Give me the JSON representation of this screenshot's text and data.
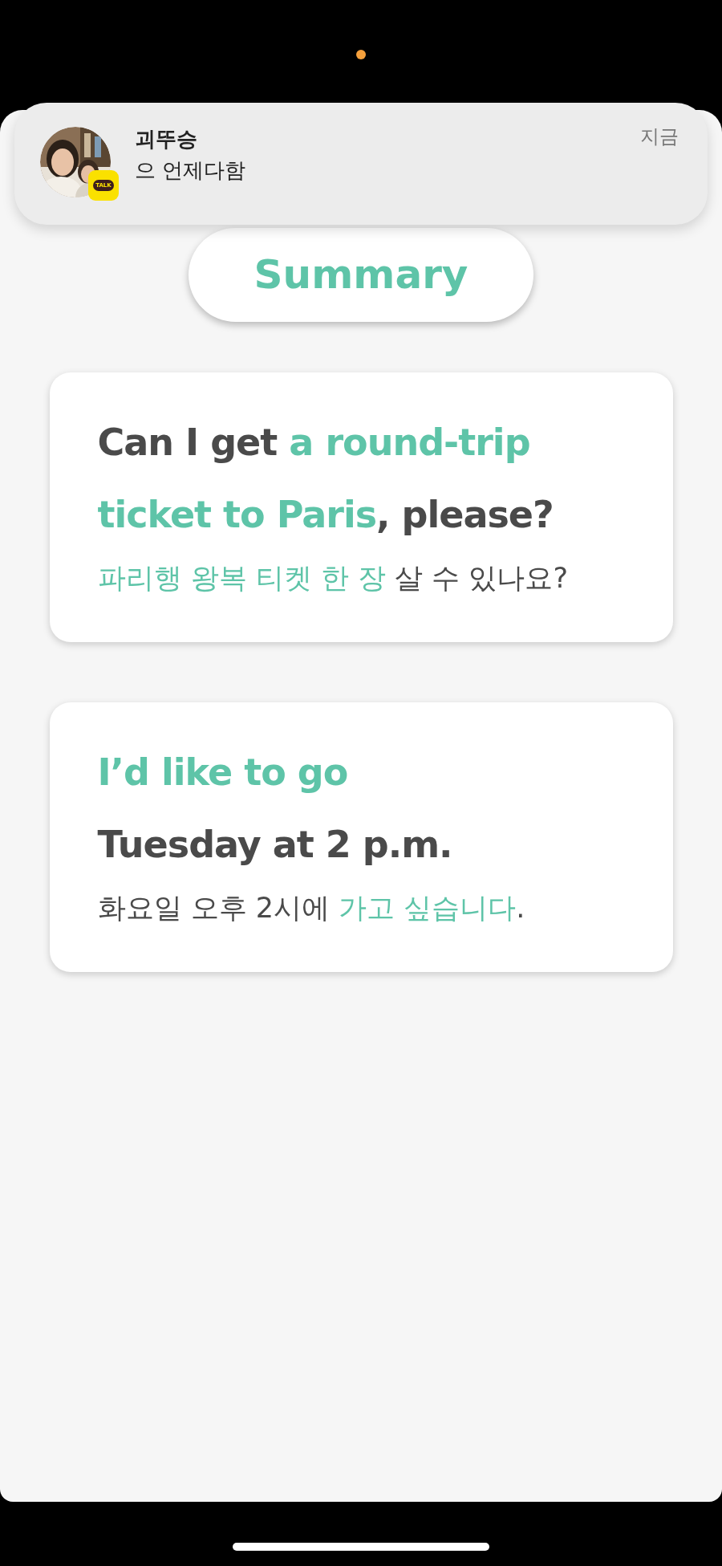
{
  "notification": {
    "sender": "괴뚜승",
    "message": "으 언제다함",
    "time": "지금",
    "badge": "TALK"
  },
  "title": "Summary",
  "cards": [
    {
      "lines": [
        [
          {
            "text": "Can I get ",
            "highlight": false
          },
          {
            "text": "a round-trip",
            "highlight": true
          }
        ],
        [
          {
            "text": "ticket to Paris",
            "highlight": true
          },
          {
            "text": ", please?",
            "highlight": false
          }
        ]
      ],
      "translation": [
        {
          "text": "파리행 왕복 티켓 한 장",
          "highlight": true
        },
        {
          "text": " 살 수 있나요?",
          "highlight": false
        }
      ]
    },
    {
      "lines": [
        [
          {
            "text": "I’d like to go",
            "highlight": true
          }
        ],
        [
          {
            "text": "Tuesday at 2 p.m.",
            "highlight": false
          }
        ]
      ],
      "translation": [
        {
          "text": "화요일 오후 2시에 ",
          "highlight": false
        },
        {
          "text": "가고 싶습니다",
          "highlight": true
        },
        {
          "text": ".",
          "highlight": false
        }
      ]
    }
  ]
}
